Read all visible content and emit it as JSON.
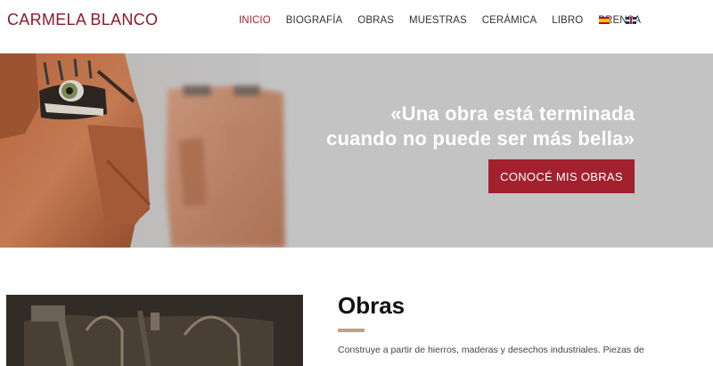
{
  "header": {
    "logo": "CARMELA BLANCO",
    "nav": [
      {
        "label": "INICIO",
        "active": true
      },
      {
        "label": "BIOGRAFÍA"
      },
      {
        "label": "OBRAS"
      },
      {
        "label": "MUESTRAS"
      },
      {
        "label": "CERÁMICA"
      },
      {
        "label": "LIBRO"
      },
      {
        "label": "PRENSA"
      }
    ],
    "languages": [
      "es-flag-icon",
      "uk-flag-icon"
    ]
  },
  "hero": {
    "quote_line1": "«Una obra está terminada",
    "quote_line2": "cuando no puede ser más bella»",
    "cta_label": "CONOCÉ MIS OBRAS"
  },
  "obras": {
    "title": "Obras",
    "text": "Construye a partir de hierros, maderas y desechos industriales. Piezas de"
  },
  "colors": {
    "accent": "#a3202f",
    "logo": "#8a1a2b",
    "hero_bg": "#c3c3c4",
    "rule": "#b9a48a"
  }
}
